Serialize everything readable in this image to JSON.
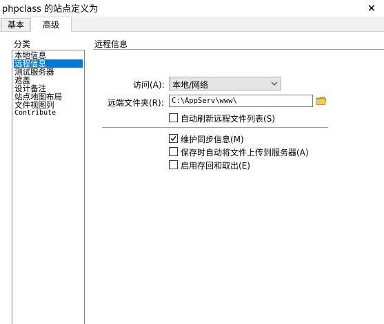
{
  "window": {
    "title": "phpclass 的站点定义为",
    "close_glyph": "✕"
  },
  "tabs": [
    {
      "label": "基本",
      "active": false
    },
    {
      "label": "高级",
      "active": true
    }
  ],
  "category": {
    "heading": "分类",
    "items": [
      {
        "label": "本地信息",
        "selected": false
      },
      {
        "label": "远程信息",
        "selected": true
      },
      {
        "label": "测试服务器",
        "selected": false
      },
      {
        "label": "遮盖",
        "selected": false
      },
      {
        "label": "设计备注",
        "selected": false
      },
      {
        "label": "站点地图布局",
        "selected": false
      },
      {
        "label": "文件视图列",
        "selected": false
      },
      {
        "label": "Contribute",
        "selected": false
      }
    ]
  },
  "remote": {
    "section_title": "远程信息",
    "access_label": "访问(A):",
    "access_value": "本地/网络",
    "folder_label": "远端文件夹(R):",
    "folder_value": "C:\\AppServ\\www\\",
    "icons": {
      "dropdown": "chevron-down-icon",
      "browse": "folder-icon",
      "check": "checkmark-icon"
    },
    "options": [
      {
        "label": "自动刷新远程文件列表(S)",
        "checked": false
      },
      {
        "label": "维护同步信息(M)",
        "checked": true
      },
      {
        "label": "保存时自动将文件上传到服务器(A)",
        "checked": false
      },
      {
        "label": "启用存回和取出(E)",
        "checked": false
      }
    ]
  }
}
